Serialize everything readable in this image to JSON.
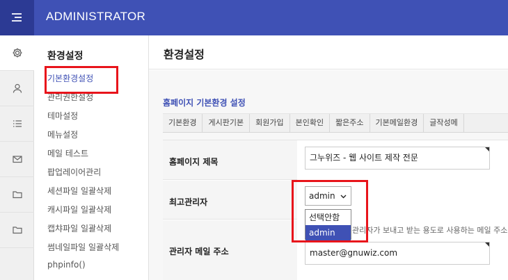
{
  "header": {
    "brand": "ADMINISTRATOR"
  },
  "rail": {
    "icons": [
      "gear-icon",
      "user-icon",
      "list-icon",
      "mail-icon",
      "folder-icon",
      "folder-icon"
    ]
  },
  "submenu": {
    "title": "환경설정",
    "items": [
      {
        "label": "기본환경설정",
        "current": true
      },
      {
        "label": "관리권한설정"
      },
      {
        "label": "테마설정"
      },
      {
        "label": "메뉴설정"
      },
      {
        "label": "메일 테스트"
      },
      {
        "label": "팝업레이어관리"
      },
      {
        "label": "세션파일 일괄삭제"
      },
      {
        "label": "캐시파일 일괄삭제"
      },
      {
        "label": "캡챠파일 일괄삭제"
      },
      {
        "label": "썸네일파일 일괄삭제"
      },
      {
        "label": "phpinfo()"
      }
    ]
  },
  "main": {
    "page_title": "환경설정",
    "section_title": "홈페이지 기본환경 설정",
    "tabs": [
      "기본환경",
      "게시판기본",
      "회원가입",
      "본인확인",
      "짧은주소",
      "기본메일환경",
      "글작성메"
    ],
    "form": {
      "homepage_title_label": "홈페이지 제목",
      "homepage_title_value": "그누위즈 - 웹 사이트 제작 전문",
      "super_admin_label": "최고관리자",
      "super_admin_value": "admin",
      "super_admin_options": [
        "선택안함",
        "admin"
      ],
      "admin_email_label": "관리자 메일 주소",
      "admin_email_help": "관리자가 보내고 받는 용도로 사용하는 메일 주소를 입력",
      "admin_email_value": "master@gnuwiz.com"
    }
  },
  "colors": {
    "header": "#3f51b5",
    "accent": "#3f51b5",
    "highlight": "#e8141b"
  }
}
